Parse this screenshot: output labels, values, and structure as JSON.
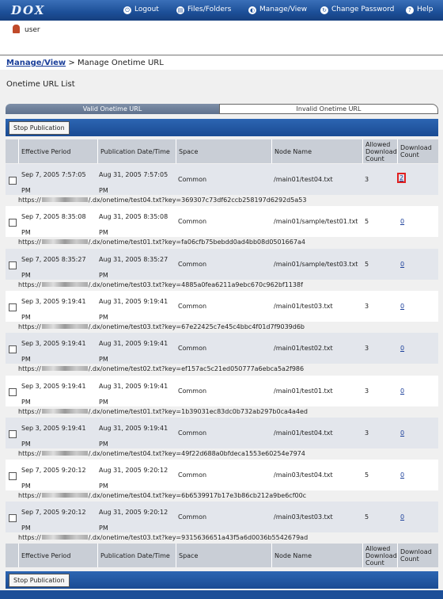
{
  "app": {
    "logo": "DOX"
  },
  "nav": [
    {
      "label": "Logout",
      "icon": "logout-icon",
      "glyph": "⏻"
    },
    {
      "label": "Files/Folders",
      "icon": "files-folders-icon",
      "glyph": "▤"
    },
    {
      "label": "Manage/View",
      "icon": "manage-view-icon",
      "glyph": "◐"
    },
    {
      "label": "Change Password",
      "icon": "change-password-icon",
      "glyph": "↻"
    },
    {
      "label": "Help",
      "icon": "help-icon",
      "glyph": "?"
    }
  ],
  "user": {
    "name": "user"
  },
  "breadcrumb": {
    "link": "Manage/View",
    "separator": ">",
    "current": "Manage Onetime URL"
  },
  "panel": {
    "title": "Onetime URL List"
  },
  "tabs": {
    "valid": "Valid Onetime URL",
    "invalid": "Invalid Onetime URL"
  },
  "actions": {
    "stop_publication": "Stop Publication"
  },
  "columns": {
    "effective_period": "Effective Period",
    "publication_date": "Publication Date/Time",
    "space": "Space",
    "node_name": "Node Name",
    "allowed_count": "Allowed Download Count",
    "download_count": "Download Count"
  },
  "rows": [
    {
      "eff1": "Sep 7, 2005 7:57:05",
      "eff2": "PM",
      "pub1": "Aug 31, 2005 7:57:05",
      "pub2": "PM",
      "space": "Common",
      "node": "/main01/test04.txt",
      "allowed": "3",
      "downloads": "2",
      "url_prefix": "https://",
      "url_suffix": "/.dx/onetime/test04.txt?key=369307c73df62ccb258197d6292d5a53"
    },
    {
      "eff1": "Sep 7, 2005 8:35:08",
      "eff2": "PM",
      "pub1": "Aug 31, 2005 8:35:08",
      "pub2": "PM",
      "space": "Common",
      "node": "/main01/sample/test01.txt",
      "allowed": "5",
      "downloads": "0",
      "url_prefix": "https://",
      "url_suffix": "/.dx/onetime/test01.txt?key=fa06cfb75bebdd0ad4bb08d0501667a4"
    },
    {
      "eff1": "Sep 7, 2005 8:35:27",
      "eff2": "PM",
      "pub1": "Aug 31, 2005 8:35:27",
      "pub2": "PM",
      "space": "Common",
      "node": "/main01/sample/test03.txt",
      "allowed": "5",
      "downloads": "0",
      "url_prefix": "https://",
      "url_suffix": "/.dx/onetime/test03.txt?key=4885a0fea6211a9ebc670c962bf1138f"
    },
    {
      "eff1": "Sep 3, 2005 9:19:41",
      "eff2": "PM",
      "pub1": "Aug 31, 2005 9:19:41",
      "pub2": "PM",
      "space": "Common",
      "node": "/main01/test03.txt",
      "allowed": "3",
      "downloads": "0",
      "url_prefix": "https://",
      "url_suffix": "/.dx/onetime/test03.txt?key=67e22425c7e45c4bbc4f01d7f9039d6b"
    },
    {
      "eff1": "Sep 3, 2005 9:19:41",
      "eff2": "PM",
      "pub1": "Aug 31, 2005 9:19:41",
      "pub2": "PM",
      "space": "Common",
      "node": "/main01/test02.txt",
      "allowed": "3",
      "downloads": "0",
      "url_prefix": "https://",
      "url_suffix": "/.dx/onetime/test02.txt?key=ef157ac5c21ed050777a6ebca5a2f986"
    },
    {
      "eff1": "Sep 3, 2005 9:19:41",
      "eff2": "PM",
      "pub1": "Aug 31, 2005 9:19:41",
      "pub2": "PM",
      "space": "Common",
      "node": "/main01/test01.txt",
      "allowed": "3",
      "downloads": "0",
      "url_prefix": "https://",
      "url_suffix": "/.dx/onetime/test01.txt?key=1b39031ec83dc0b732ab297b0ca4a4ed"
    },
    {
      "eff1": "Sep 3, 2005 9:19:41",
      "eff2": "PM",
      "pub1": "Aug 31, 2005 9:19:41",
      "pub2": "PM",
      "space": "Common",
      "node": "/main01/test04.txt",
      "allowed": "3",
      "downloads": "0",
      "url_prefix": "https://",
      "url_suffix": "/.dx/onetime/test04.txt?key=49f22d688a0bfdeca1553e60254e7974"
    },
    {
      "eff1": "Sep 7, 2005 9:20:12",
      "eff2": "PM",
      "pub1": "Aug 31, 2005 9:20:12",
      "pub2": "PM",
      "space": "Common",
      "node": "/main03/test04.txt",
      "allowed": "5",
      "downloads": "0",
      "url_prefix": "https://",
      "url_suffix": "/.dx/onetime/test04.txt?key=6b6539917b17e3b86cb212a9be6cf00c"
    },
    {
      "eff1": "Sep 7, 2005 9:20:12",
      "eff2": "PM",
      "pub1": "Aug 31, 2005 9:20:12",
      "pub2": "PM",
      "space": "Common",
      "node": "/main03/test03.txt",
      "allowed": "5",
      "downloads": "0",
      "url_prefix": "https://",
      "url_suffix": "/.dx/onetime/test03.txt?key=9315636651a43f5a6d0036b5542679ad"
    }
  ]
}
